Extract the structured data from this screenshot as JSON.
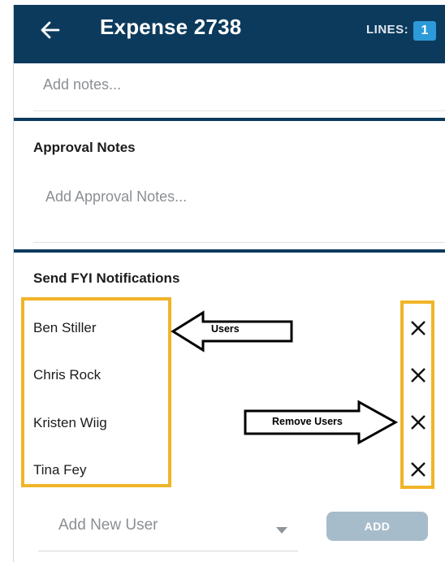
{
  "header": {
    "title": "Expense 2738",
    "lines_label": "LINES:",
    "lines_count": "1",
    "back_icon": "arrow-left-icon"
  },
  "notes": {
    "placeholder": "Add notes..."
  },
  "approval_notes": {
    "heading": "Approval Notes",
    "placeholder": "Add Approval Notes..."
  },
  "fyi": {
    "heading": "Send FYI Notifications",
    "users": [
      "Ben Stiller",
      "Chris Rock",
      "Kristen Wiig",
      "Tina Fey"
    ],
    "remove_icon": "close-icon",
    "add_user_placeholder": "Add New User",
    "add_button": "ADD"
  },
  "annotations": {
    "users_label": "Users",
    "remove_label": "Remove Users"
  },
  "colors": {
    "header_bg": "#0c3a5c",
    "badge_bg": "#2c9ad9",
    "highlight": "#f0b428",
    "add_button_bg": "#a7bccb"
  }
}
